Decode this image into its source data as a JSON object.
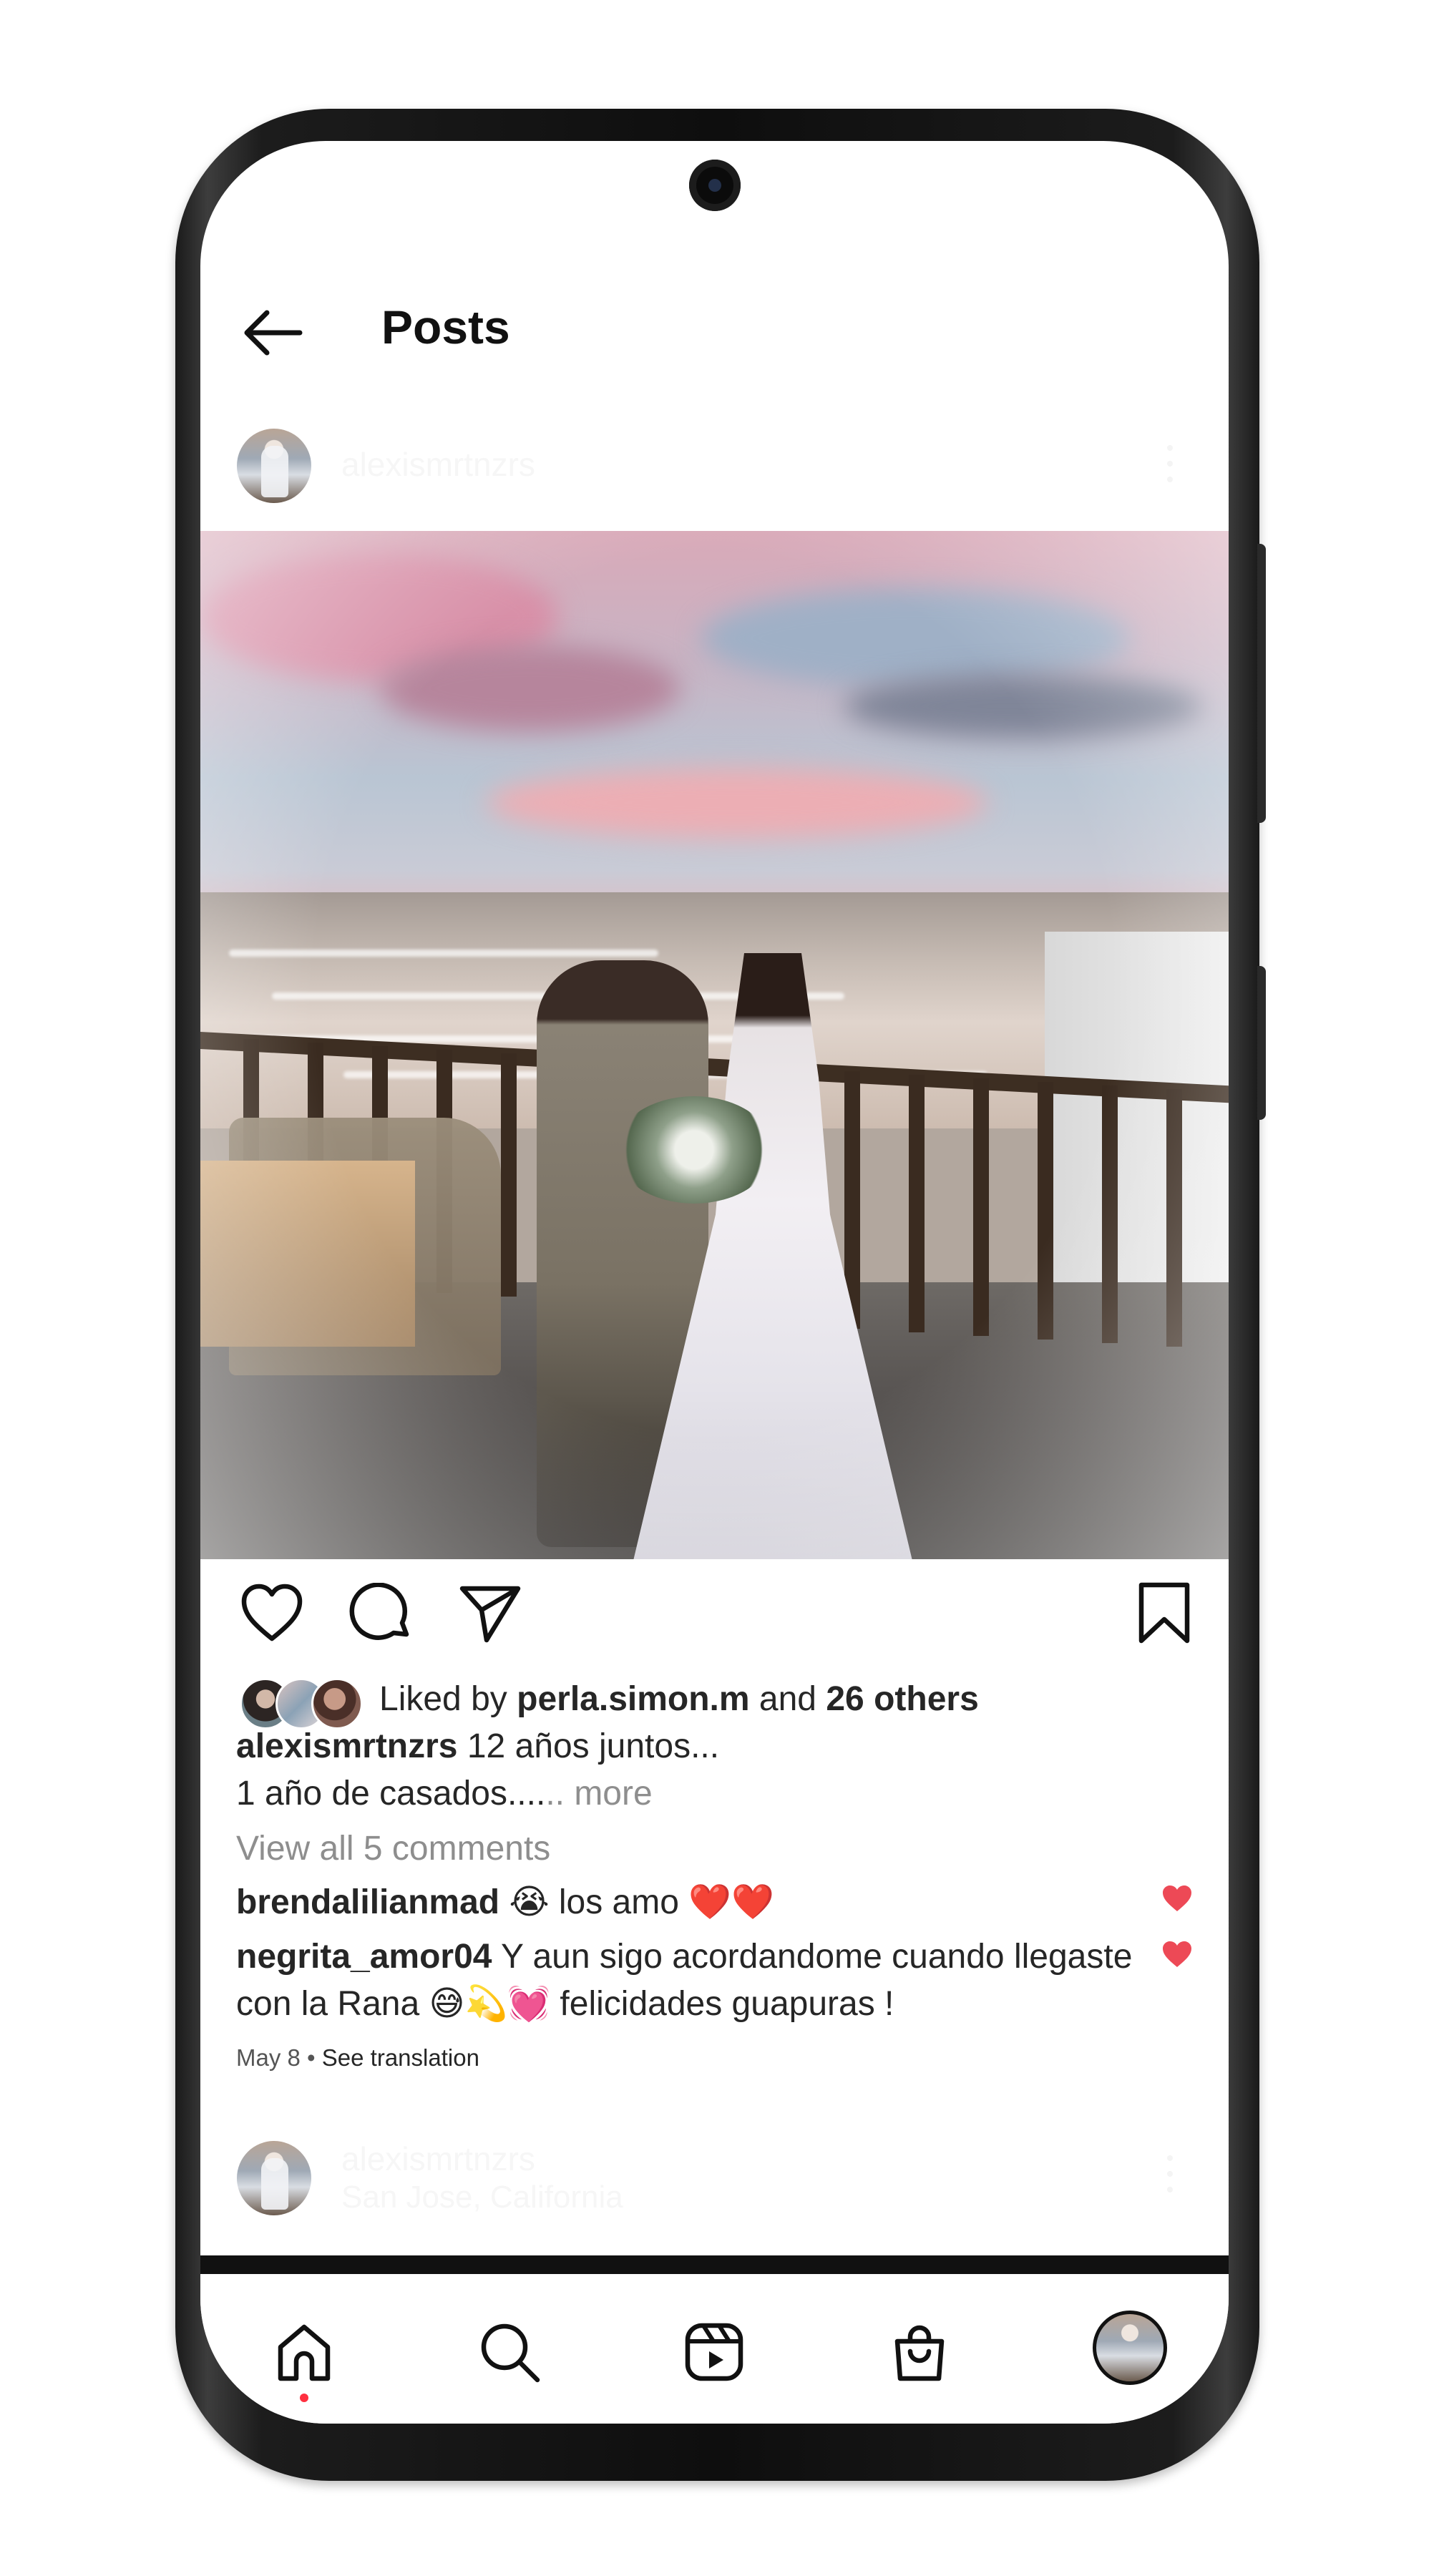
{
  "header": {
    "title": "Posts",
    "back_icon": "arrow-left-icon"
  },
  "post": {
    "username": "alexismrtnzrs",
    "likes": {
      "prefix": "Liked by",
      "first_liker": "perla.simon.m",
      "joiner": "and",
      "others": "26 others"
    },
    "caption": {
      "username": "alexismrtnzrs",
      "line1": "12 años juntos...",
      "line2": "1 año de casados....",
      "more": ".. more"
    },
    "view_comments": "View all 5 comments",
    "comments": [
      {
        "username": "brendalilianmad",
        "text": "😭 los amo ❤️❤️",
        "liked_icon": "heart-filled-icon"
      },
      {
        "username": "negrita_amor04",
        "text_line1": "Y aun sigo acordandome cuando llegaste",
        "text_line2": "con la Rana 😅💫💓 felicidades guapuras !",
        "liked_icon": "heart-filled-icon"
      }
    ],
    "date": "May 8",
    "separator": "•",
    "see_translation": "See translation",
    "actions": [
      "heart-icon",
      "comment-icon",
      "share-icon",
      "bookmark-icon"
    ]
  },
  "next_post": {
    "username": "alexismrtnzrs",
    "location": "San Jose, California"
  },
  "bottom_nav": {
    "items": [
      "home-icon",
      "search-icon",
      "reels-icon",
      "shop-icon",
      "profile-avatar"
    ],
    "active": "home-icon",
    "notification_color": "#ff3040"
  },
  "colors": {
    "text": "#262626",
    "muted": "#8e8e8e",
    "heart_red": "#ed4956",
    "background": "#ffffff"
  }
}
